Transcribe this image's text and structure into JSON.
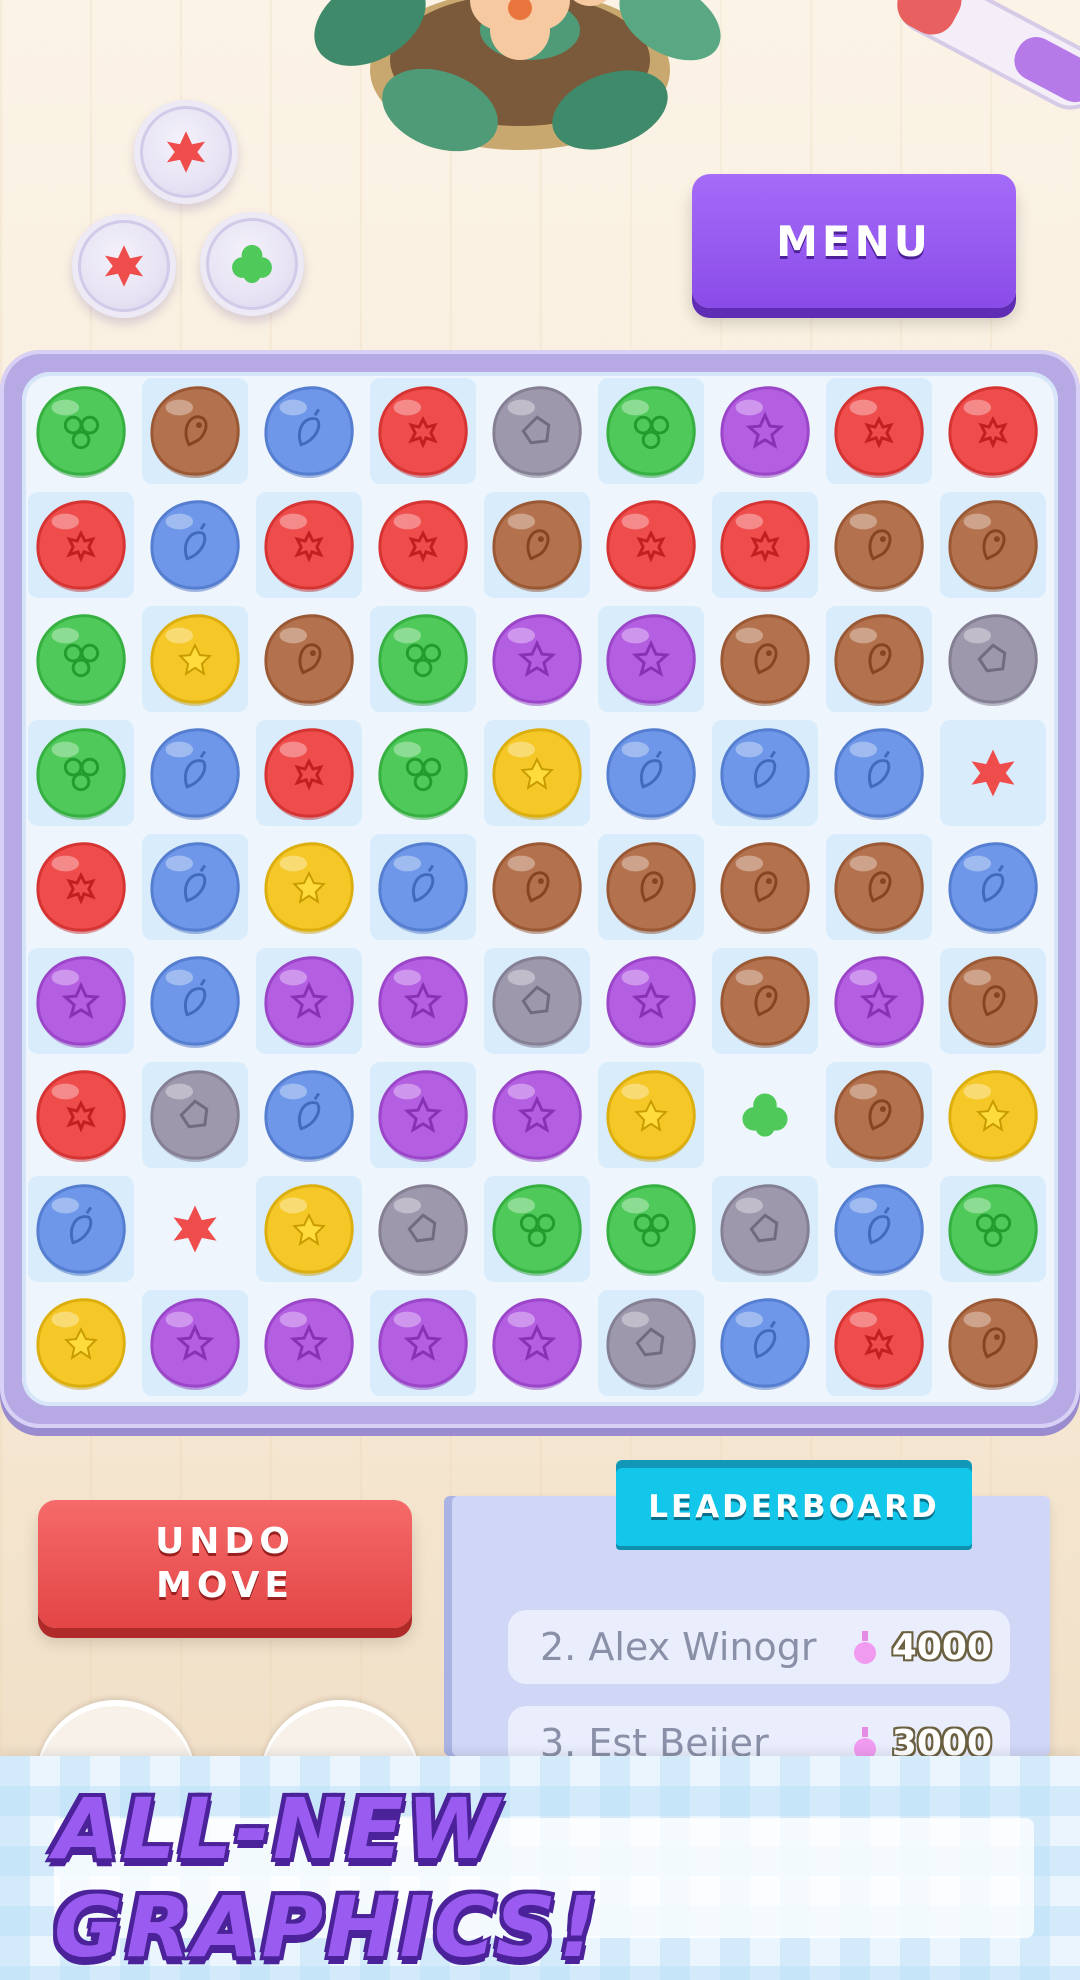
{
  "menu": {
    "label": "MENU"
  },
  "undo": {
    "label": "UNDO\nMOVE"
  },
  "leaderboard": {
    "title": "LEADERBOARD",
    "entries": [
      {
        "name": "2. Alex Winogr",
        "score": "4000"
      },
      {
        "name": "3. Est Beijer",
        "score": "3000"
      }
    ]
  },
  "banner": {
    "text": "ALL-NEW GRAPHICS!"
  },
  "queue": [
    "red-star-germ-icon",
    "red-star-germ-icon",
    "green-blob-germ-icon"
  ],
  "colors": {
    "green": "#4fc95a",
    "brown": "#b3724d",
    "blue": "#6e97e9",
    "red": "#ef4c4c",
    "gray": "#9e98ad",
    "purple": "#b45ee2",
    "yellow": "#f5c827",
    "menu": "#9b5cf3",
    "undo": "#ee5353",
    "leaderboard_tab": "#13c7ea"
  },
  "board": {
    "rows": 9,
    "cols": 9,
    "grid": [
      [
        "green",
        "brown",
        "blue",
        "red",
        "gray",
        "green",
        "purple",
        "red",
        "red"
      ],
      [
        "red",
        "blue",
        "red",
        "red",
        "brown",
        "red",
        "red",
        "brown",
        "brown"
      ],
      [
        "green",
        "yellow",
        "brown",
        "green",
        "purple",
        "purple",
        "brown",
        "brown",
        "gray"
      ],
      [
        "green",
        "blue",
        "red",
        "green",
        "yellow",
        "blue",
        "blue",
        "blue",
        "red-small"
      ],
      [
        "red",
        "blue",
        "yellow",
        "blue",
        "brown",
        "brown",
        "brown",
        "brown",
        "blue"
      ],
      [
        "purple",
        "blue",
        "purple",
        "purple",
        "gray",
        "purple",
        "brown",
        "purple",
        "brown"
      ],
      [
        "red",
        "gray",
        "blue",
        "purple",
        "purple",
        "yellow",
        "green-small",
        "brown",
        "yellow"
      ],
      [
        "blue",
        "red-small",
        "yellow",
        "gray",
        "green",
        "green",
        "gray",
        "blue",
        "green"
      ],
      [
        "yellow",
        "purple",
        "purple",
        "purple",
        "purple",
        "gray",
        "blue",
        "red",
        "brown"
      ]
    ]
  }
}
